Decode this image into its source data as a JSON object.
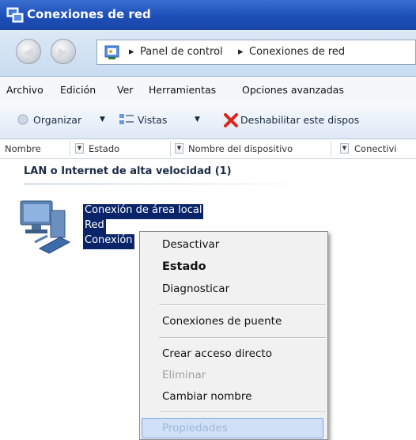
{
  "window": {
    "title": "Conexiones de red"
  },
  "nav": {
    "back_icon": "back-arrow-icon",
    "forward_icon": "forward-arrow-icon",
    "breadcrumbs": [
      "Panel de control",
      "Conexiones de red"
    ],
    "separator": "▸"
  },
  "menu": [
    "Archivo",
    "Edición",
    "Ver",
    "Herramientas",
    "Opciones avanzadas"
  ],
  "toolbar": {
    "organize": "Organizar",
    "views": "Vistas",
    "disable": "Deshabilitar este dispos",
    "dropdown_glyph": "▼"
  },
  "columns": [
    "Nombre",
    "Estado",
    "Nombre del dispositivo",
    "Conectivi"
  ],
  "group": {
    "title": "LAN o Internet de alta velocidad (1)"
  },
  "connection": {
    "name": "Conexión de área local",
    "network": "Red",
    "device": "Conexión"
  },
  "context_menu": {
    "items": [
      {
        "label": "Desactivar",
        "enabled": true,
        "bold": false
      },
      {
        "label": "Estado",
        "enabled": true,
        "bold": true
      },
      {
        "label": "Diagnosticar",
        "enabled": true,
        "bold": false
      },
      {
        "label": "Conexiones de puente",
        "enabled": true,
        "bold": false
      },
      {
        "label": "Crear acceso directo",
        "enabled": true,
        "bold": false
      },
      {
        "label": "Eliminar",
        "enabled": false,
        "bold": false
      },
      {
        "label": "Cambiar nombre",
        "enabled": true,
        "bold": false
      },
      {
        "label": "Propiedades",
        "enabled": true,
        "bold": false,
        "highlighted": true
      }
    ]
  },
  "colors": {
    "title_bar": "#1d4fb8",
    "selection": "#0a246a",
    "menu_highlight": "#cfe0f7"
  }
}
